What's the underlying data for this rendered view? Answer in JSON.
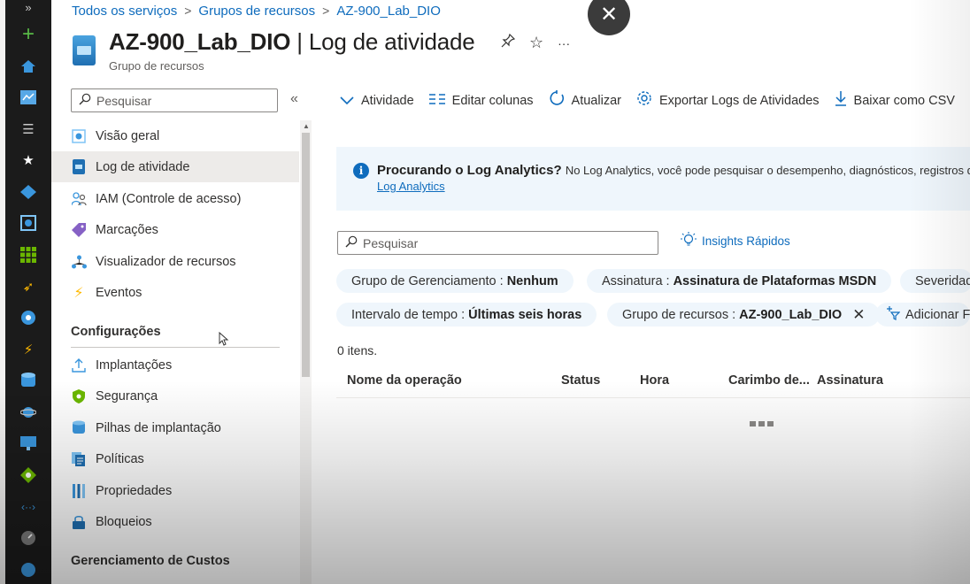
{
  "breadcrumb": [
    "Todos os serviços",
    "Grupos de recursos",
    "AZ-900_Lab_DIO"
  ],
  "header": {
    "title_name": "AZ-900_Lab_DIO",
    "title_section": " | Log de atividade",
    "subtitle": "Grupo de recursos"
  },
  "nav": {
    "search_placeholder": "Pesquisar",
    "items": [
      {
        "label": "Visão geral",
        "icon": "overview-icon"
      },
      {
        "label": "Log de atividade",
        "icon": "activity-log-icon"
      },
      {
        "label": "IAM (Controle de acesso)",
        "icon": "iam-icon"
      },
      {
        "label": "Marcações",
        "icon": "tag-icon"
      },
      {
        "label": "Visualizador de recursos",
        "icon": "resource-visualizer-icon"
      },
      {
        "label": "Eventos",
        "icon": "events-icon"
      }
    ],
    "section_config": "Configurações",
    "config_items": [
      {
        "label": "Implantações",
        "icon": "deployments-icon"
      },
      {
        "label": "Segurança",
        "icon": "security-icon"
      },
      {
        "label": "Pilhas de implantação",
        "icon": "deployment-stacks-icon"
      },
      {
        "label": "Políticas",
        "icon": "policies-icon"
      },
      {
        "label": "Propriedades",
        "icon": "properties-icon"
      },
      {
        "label": "Bloqueios",
        "icon": "locks-icon"
      }
    ],
    "section_costs": "Gerenciamento de Custos"
  },
  "toolbar": {
    "activity": "Atividade",
    "edit_columns": "Editar colunas",
    "refresh": "Atualizar",
    "export": "Exportar Logs de Atividades",
    "download_csv": "Baixar como CSV"
  },
  "banner": {
    "title": "Procurando o Log Analytics?",
    "description": "No Log Analytics, você pode pesquisar o desempenho, diagnósticos, registros d",
    "link": "Log Analytics"
  },
  "filters": {
    "search_placeholder": "Pesquisar",
    "insights": "Insights Rápidos",
    "pill1_label": "Grupo de Gerenciamento :",
    "pill1_value": "Nenhum",
    "pill2_label": "Assinatura :",
    "pill2_value": "Assinatura de Plataformas MSDN",
    "pill3_label": "Severidad",
    "pill4_label": "Intervalo de tempo :",
    "pill4_value": "Últimas seis horas",
    "pill5_label": "Grupo de recursos :",
    "pill5_value": "AZ-900_Lab_DIO",
    "add_filter": "Adicionar F"
  },
  "results": {
    "count": "0 itens.",
    "columns": [
      "Nome da operação",
      "Status",
      "Hora",
      "Carimbo de...",
      "Assinatura"
    ]
  },
  "colors": {
    "accent": "#0f6cbd",
    "rail": "#1b1b1b",
    "pill_bg": "#eff6fc"
  }
}
